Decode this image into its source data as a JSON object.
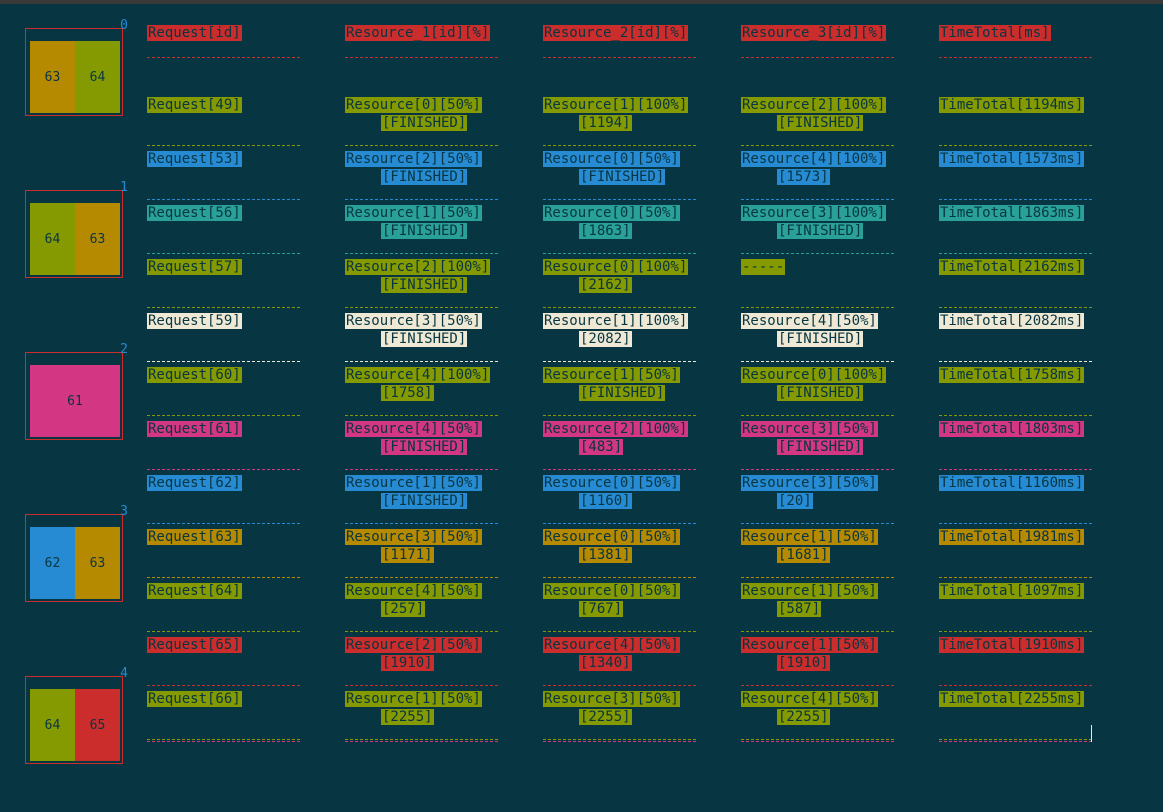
{
  "colors": {
    "background": "#073642",
    "red": "#cb2d2d",
    "yellow": "#b58900",
    "olive": "#859900",
    "blue": "#268bd2",
    "cyan": "#2aa198",
    "cream": "#eee8d5",
    "magenta": "#d33682"
  },
  "header": {
    "request": "Request[id]",
    "resource1": "Resource_1[id][%]",
    "resource2": "Resource_2[id][%]",
    "resource3": "Resource_3[id][%]",
    "time": "TimeTotal[ms]"
  },
  "resources": [
    {
      "index": "0",
      "slots": [
        "63",
        "64"
      ]
    },
    {
      "index": "1",
      "slots": [
        "64",
        "63"
      ]
    },
    {
      "index": "2",
      "slots": [
        "61"
      ]
    },
    {
      "index": "3",
      "slots": [
        "62",
        "63"
      ]
    },
    {
      "index": "4",
      "slots": [
        "64",
        "65"
      ]
    }
  ],
  "rows": [
    {
      "request": "Request[49]",
      "r1": "Resource[0][50%]",
      "r1s": "[FINISHED]",
      "r2": "Resource[1][100%]",
      "r2s": "[1194]",
      "r3": "Resource[2][100%]",
      "r3s": "[FINISHED]",
      "time": "TimeTotal[1194ms]",
      "color": "olive"
    },
    {
      "request": "Request[53]",
      "r1": "Resource[2][50%]",
      "r1s": "[FINISHED]",
      "r2": "Resource[0][50%]",
      "r2s": "[FINISHED]",
      "r3": "Resource[4][100%]",
      "r3s": "[1573]",
      "time": "TimeTotal[1573ms]",
      "color": "blue"
    },
    {
      "request": "Request[56]",
      "r1": "Resource[1][50%]",
      "r1s": "[FINISHED]",
      "r2": "Resource[0][50%]",
      "r2s": "[1863]",
      "r3": "Resource[3][100%]",
      "r3s": "[FINISHED]",
      "time": "TimeTotal[1863ms]",
      "color": "cyan"
    },
    {
      "request": "Request[57]",
      "r1": "Resource[2][100%]",
      "r1s": "[FINISHED]",
      "r2": "Resource[0][100%]",
      "r2s": "[2162]",
      "r3": "-----",
      "r3s": "",
      "time": "TimeTotal[2162ms]",
      "color": "olive"
    },
    {
      "request": "Request[59]",
      "r1": "Resource[3][50%]",
      "r1s": "[FINISHED]",
      "r2": "Resource[1][100%]",
      "r2s": "[2082]",
      "r3": "Resource[4][50%]",
      "r3s": "[FINISHED]",
      "time": "TimeTotal[2082ms]",
      "color": "cream"
    },
    {
      "request": "Request[60]",
      "r1": "Resource[4][100%]",
      "r1s": "[1758]",
      "r2": "Resource[1][50%]",
      "r2s": "[FINISHED]",
      "r3": "Resource[0][100%]",
      "r3s": "[FINISHED]",
      "time": "TimeTotal[1758ms]",
      "color": "olive"
    },
    {
      "request": "Request[61]",
      "r1": "Resource[4][50%]",
      "r1s": "[FINISHED]",
      "r2": "Resource[2][100%]",
      "r2s": "[483]",
      "r3": "Resource[3][50%]",
      "r3s": "[FINISHED]",
      "time": "TimeTotal[1803ms]",
      "color": "magenta"
    },
    {
      "request": "Request[62]",
      "r1": "Resource[1][50%]",
      "r1s": "[FINISHED]",
      "r2": "Resource[0][50%]",
      "r2s": "[1160]",
      "r3": "Resource[3][50%]",
      "r3s": "[20]",
      "time": "TimeTotal[1160ms]",
      "color": "blue"
    },
    {
      "request": "Request[63]",
      "r1": "Resource[3][50%]",
      "r1s": "[1171]",
      "r2": "Resource[0][50%]",
      "r2s": "[1381]",
      "r3": "Resource[1][50%]",
      "r3s": "[1681]",
      "time": "TimeTotal[1981ms]",
      "color": "yellow"
    },
    {
      "request": "Request[64]",
      "r1": "Resource[4][50%]",
      "r1s": "[257]",
      "r2": "Resource[0][50%]",
      "r2s": "[767]",
      "r3": "Resource[1][50%]",
      "r3s": "[587]",
      "time": "TimeTotal[1097ms]",
      "color": "olive"
    },
    {
      "request": "Request[65]",
      "r1": "Resource[2][50%]",
      "r1s": "[1910]",
      "r2": "Resource[4][50%]",
      "r2s": "[1340]",
      "r3": "Resource[1][50%]",
      "r3s": "[1910]",
      "time": "TimeTotal[1910ms]",
      "color": "red"
    },
    {
      "request": "Request[66]",
      "r1": "Resource[1][50%]",
      "r1s": "[2255]",
      "r2": "Resource[3][50%]",
      "r2s": "[2255]",
      "r3": "Resource[4][50%]",
      "r3s": "[2255]",
      "time": "TimeTotal[2255ms]",
      "color": "olive"
    }
  ]
}
